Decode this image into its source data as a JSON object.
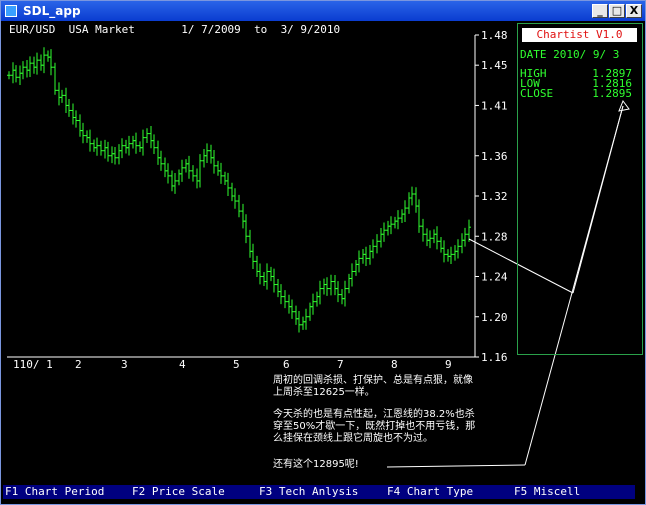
{
  "window": {
    "title": "SDL_app",
    "colors": {
      "titlebar": "#0a3cd0",
      "up": "#30ff30",
      "panel_border": "#2aa14a",
      "menu_bg": "#000080"
    }
  },
  "controls": {
    "minimize": "_",
    "restore": "□",
    "close": "X"
  },
  "header": {
    "pair": "EUR/USD",
    "market": "USA Market",
    "date_from": "1/ 7/2009",
    "to_label": "to",
    "date_to": "3/ 9/2010"
  },
  "panel": {
    "title": "Chartist V1.0",
    "date_label": "DATE",
    "date_value": "2010/ 9/ 3",
    "high_label": "HIGH",
    "high_value": "1.2897",
    "low_label": "LOW",
    "low_value": "1.2816",
    "close_label": "CLOSE",
    "close_value": "1.2895"
  },
  "annotations": {
    "para1_line1": "周初的回调杀损、打保护、总是有点狠，就像",
    "para1_line2": "上周杀至12625一样。",
    "para2_line1": "今天杀的也是有点性起，江恩线的38.2%也杀",
    "para2_line2": "穿至50%才歇一下，既然打掉也不用亏钱，那",
    "para2_line3": "么挂保在颈线上跟它周旋也不为过。",
    "para3": "还有这个12895呢!"
  },
  "menu": [
    {
      "key": "F1",
      "label": "Chart Period"
    },
    {
      "key": "F2",
      "label": "Price Scale"
    },
    {
      "key": "F3",
      "label": "Tech Anlysis"
    },
    {
      "key": "F4",
      "label": "Chart Type"
    },
    {
      "key": "F5",
      "label": "Miscell"
    }
  ],
  "chart_data": {
    "type": "ohlc",
    "x_tick_labels": [
      "110/ 1",
      "2",
      "3",
      "4",
      "5",
      "6",
      "7",
      "8",
      "9"
    ],
    "y_ticks": [
      1.48,
      1.45,
      1.41,
      1.36,
      1.32,
      1.28,
      1.24,
      1.2,
      1.16
    ],
    "y_tick_labels": [
      "1.48",
      "1.45",
      "1.41",
      "1.36",
      "1.32",
      "1.28",
      "1.24",
      "1.20",
      "1.16"
    ],
    "ylim": [
      1.16,
      1.48
    ],
    "series_color": "#30ff30",
    "closes": [
      1.44,
      1.445,
      1.438,
      1.442,
      1.448,
      1.445,
      1.452,
      1.448,
      1.455,
      1.45,
      1.46,
      1.458,
      1.448,
      1.425,
      1.418,
      1.42,
      1.41,
      1.405,
      1.398,
      1.395,
      1.385,
      1.38,
      1.378,
      1.372,
      1.368,
      1.37,
      1.365,
      1.368,
      1.36,
      1.362,
      1.358,
      1.365,
      1.37,
      1.368,
      1.372,
      1.375,
      1.37,
      1.368,
      1.378,
      1.382,
      1.375,
      1.368,
      1.358,
      1.352,
      1.345,
      1.34,
      1.33,
      1.335,
      1.342,
      1.348,
      1.352,
      1.345,
      1.34,
      1.335,
      1.355,
      1.36,
      1.365,
      1.358,
      1.35,
      1.345,
      1.34,
      1.335,
      1.328,
      1.32,
      1.315,
      1.305,
      1.295,
      1.28,
      1.265,
      1.255,
      1.245,
      1.24,
      1.235,
      1.245,
      1.24,
      1.232,
      1.225,
      1.22,
      1.215,
      1.21,
      1.205,
      1.198,
      1.192,
      1.195,
      1.2,
      1.21,
      1.215,
      1.22,
      1.228,
      1.232,
      1.228,
      1.235,
      1.228,
      1.222,
      1.218,
      1.228,
      1.238,
      1.245,
      1.252,
      1.258,
      1.262,
      1.258,
      1.265,
      1.27,
      1.275,
      1.282,
      1.286,
      1.29,
      1.292,
      1.295,
      1.298,
      1.302,
      1.308,
      1.318,
      1.322,
      1.31,
      1.29,
      1.282,
      1.276,
      1.278,
      1.282,
      1.275,
      1.268,
      1.262,
      1.26,
      1.262,
      1.265,
      1.27,
      1.276,
      1.282,
      1.289
    ]
  }
}
